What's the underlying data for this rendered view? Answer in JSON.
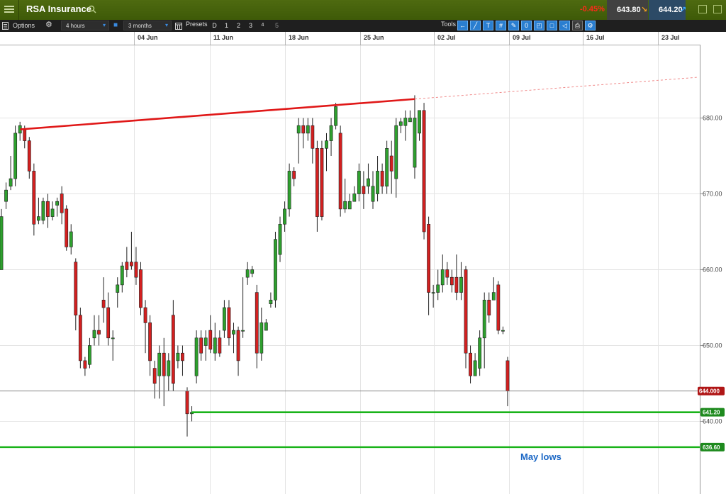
{
  "app": {
    "instrument": "RSA Insurance",
    "change": "-0.45%",
    "bid": "643.80",
    "ask": "644.20"
  },
  "toolbar": {
    "options_label": "Options",
    "interval": "4 hours",
    "range": "3 months",
    "presets_label": "Presets",
    "preset_items": [
      "D",
      "1",
      "2",
      "3",
      "4",
      "5"
    ],
    "tools_label": "Tools"
  },
  "colors": {
    "up": "#2ea02e",
    "down": "#d42020",
    "trendline": "#e01818",
    "support": "#19b319",
    "annotation": "#1b67c5"
  },
  "chart_data": {
    "type": "candlestick",
    "interval": "4 hours",
    "x_tick_labels": [
      "04 Jun",
      "11 Jun",
      "18 Jun",
      "25 Jun",
      "02 Jul",
      "09 Jul",
      "16 Jul",
      "23 Jul"
    ],
    "y_ticks": [
      640,
      650,
      660,
      670,
      680
    ],
    "ylim": [
      635,
      690
    ],
    "grid": true,
    "current_price": 644.0,
    "current_price_label": "644.000",
    "candles": [
      {
        "o": 660,
        "c": 667,
        "h": 668,
        "l": 660
      },
      {
        "o": 669,
        "c": 670.5,
        "h": 671.5,
        "l": 668
      },
      {
        "o": 671,
        "c": 672,
        "h": 675,
        "l": 670.5
      },
      {
        "o": 672,
        "c": 678,
        "h": 679,
        "l": 671
      },
      {
        "o": 678,
        "c": 679,
        "h": 679.5,
        "l": 677
      },
      {
        "o": 678.5,
        "c": 677,
        "h": 679,
        "l": 676
      },
      {
        "o": 677,
        "c": 673,
        "h": 677.5,
        "l": 672
      },
      {
        "o": 673,
        "c": 666,
        "h": 674,
        "l": 664.5
      },
      {
        "o": 666.5,
        "c": 667,
        "h": 669.5,
        "l": 666
      },
      {
        "o": 666.5,
        "c": 669,
        "h": 669.5,
        "l": 666
      },
      {
        "o": 669,
        "c": 667,
        "h": 670,
        "l": 665.5
      },
      {
        "o": 667,
        "c": 668,
        "h": 669,
        "l": 666.5
      },
      {
        "o": 668.5,
        "c": 669,
        "h": 669.5,
        "l": 667
      },
      {
        "o": 670,
        "c": 667.5,
        "h": 671,
        "l": 666
      },
      {
        "o": 668,
        "c": 663,
        "h": 668.5,
        "l": 662.5
      },
      {
        "o": 663,
        "c": 665,
        "h": 666,
        "l": 662
      },
      {
        "o": 661,
        "c": 654,
        "h": 661.5,
        "l": 652
      },
      {
        "o": 654,
        "c": 648,
        "h": 655,
        "l": 647
      },
      {
        "o": 648,
        "c": 647,
        "h": 648.5,
        "l": 646
      },
      {
        "o": 647.5,
        "c": 650,
        "h": 651,
        "l": 647
      },
      {
        "o": 651,
        "c": 652,
        "h": 654,
        "l": 650
      },
      {
        "o": 652,
        "c": 651.5,
        "h": 654,
        "l": 650
      },
      {
        "o": 656,
        "c": 655,
        "h": 659,
        "l": 653
      },
      {
        "o": 655,
        "c": 651,
        "h": 657,
        "l": 650
      },
      {
        "o": 651,
        "c": 651,
        "h": 652,
        "l": 648
      },
      {
        "o": 657,
        "c": 658,
        "h": 659,
        "l": 655
      },
      {
        "o": 658,
        "c": 660.5,
        "h": 661,
        "l": 657
      },
      {
        "o": 661,
        "c": 660,
        "h": 663,
        "l": 659
      },
      {
        "o": 661,
        "c": 660.5,
        "h": 665,
        "l": 660
      },
      {
        "o": 661,
        "c": 659,
        "h": 663,
        "l": 658
      },
      {
        "o": 660,
        "c": 655,
        "h": 661,
        "l": 654
      },
      {
        "o": 655,
        "c": 653,
        "h": 656,
        "l": 649
      },
      {
        "o": 653,
        "c": 648,
        "h": 654,
        "l": 646
      },
      {
        "o": 647,
        "c": 645,
        "h": 648,
        "l": 643
      },
      {
        "o": 646,
        "c": 649,
        "h": 650,
        "l": 643
      },
      {
        "o": 649,
        "c": 646,
        "h": 651,
        "l": 642
      },
      {
        "o": 646,
        "c": 648,
        "h": 649,
        "l": 644
      },
      {
        "o": 654,
        "c": 645,
        "h": 656,
        "l": 644
      },
      {
        "o": 648,
        "c": 649,
        "h": 650,
        "l": 647
      },
      {
        "o": 649,
        "c": 648,
        "h": 650,
        "l": 646
      },
      {
        "o": 644,
        "c": 641,
        "h": 644.5,
        "l": 638
      },
      {
        "o": 641,
        "c": 641.2,
        "h": 642,
        "l": 640
      },
      {
        "o": 646,
        "c": 651,
        "h": 652,
        "l": 645
      },
      {
        "o": 651,
        "c": 649,
        "h": 652,
        "l": 648
      },
      {
        "o": 650,
        "c": 651,
        "h": 652,
        "l": 648
      },
      {
        "o": 652,
        "c": 649.5,
        "h": 654,
        "l": 649
      },
      {
        "o": 649,
        "c": 651,
        "h": 653,
        "l": 648
      },
      {
        "o": 651,
        "c": 649,
        "h": 652,
        "l": 648.5
      },
      {
        "o": 652,
        "c": 655,
        "h": 656,
        "l": 651
      },
      {
        "o": 655,
        "c": 651,
        "h": 656,
        "l": 650
      },
      {
        "o": 651.5,
        "c": 652,
        "h": 653,
        "l": 649
      },
      {
        "o": 652,
        "c": 648,
        "h": 652.5,
        "l": 646
      },
      {
        "o": 652,
        "c": 652,
        "h": 659,
        "l": 651
      },
      {
        "o": 659,
        "c": 660,
        "h": 661,
        "l": 658
      },
      {
        "o": 659.5,
        "c": 660,
        "h": 660.5,
        "l": 659
      },
      {
        "o": 657,
        "c": 649,
        "h": 658,
        "l": 647
      },
      {
        "o": 649,
        "c": 653,
        "h": 655,
        "l": 648
      },
      {
        "o": 652,
        "c": 653,
        "h": 653.5,
        "l": 652
      },
      {
        "o": 655.5,
        "c": 656,
        "h": 657,
        "l": 655
      },
      {
        "o": 656,
        "c": 664,
        "h": 665,
        "l": 655
      },
      {
        "o": 662,
        "c": 666,
        "h": 667,
        "l": 661
      },
      {
        "o": 666,
        "c": 668,
        "h": 669,
        "l": 665
      },
      {
        "o": 668,
        "c": 673,
        "h": 674,
        "l": 667
      },
      {
        "o": 673,
        "c": 672,
        "h": 673.5,
        "l": 671
      },
      {
        "o": 678,
        "c": 679,
        "h": 680,
        "l": 674
      },
      {
        "o": 679,
        "c": 678,
        "h": 680,
        "l": 676
      },
      {
        "o": 678,
        "c": 679,
        "h": 680,
        "l": 677
      },
      {
        "o": 679,
        "c": 676,
        "h": 680,
        "l": 674
      },
      {
        "o": 676,
        "c": 667,
        "h": 677,
        "l": 665
      },
      {
        "o": 676,
        "c": 667,
        "h": 677,
        "l": 666.5
      },
      {
        "o": 676,
        "c": 677,
        "h": 678,
        "l": 673
      },
      {
        "o": 677,
        "c": 679,
        "h": 680,
        "l": 675
      },
      {
        "o": 679,
        "c": 681.5,
        "h": 682,
        "l": 678.5
      },
      {
        "o": 678,
        "c": 668,
        "h": 679,
        "l": 667
      },
      {
        "o": 668,
        "c": 669,
        "h": 672,
        "l": 667.5
      },
      {
        "o": 668,
        "c": 669,
        "h": 670,
        "l": 668
      },
      {
        "o": 669,
        "c": 670,
        "h": 671,
        "l": 669
      },
      {
        "o": 670,
        "c": 673,
        "h": 674,
        "l": 669
      },
      {
        "o": 671,
        "c": 670,
        "h": 673,
        "l": 668
      },
      {
        "o": 671,
        "c": 672,
        "h": 674,
        "l": 670
      },
      {
        "o": 669,
        "c": 671,
        "h": 673,
        "l": 668
      },
      {
        "o": 670,
        "c": 673,
        "h": 675,
        "l": 669
      },
      {
        "o": 673,
        "c": 671,
        "h": 674,
        "l": 670
      },
      {
        "o": 671,
        "c": 676,
        "h": 677,
        "l": 670
      },
      {
        "o": 675,
        "c": 673,
        "h": 677,
        "l": 670
      },
      {
        "o": 672,
        "c": 679,
        "h": 680,
        "l": 669.5
      },
      {
        "o": 679,
        "c": 679.5,
        "h": 680,
        "l": 678
      },
      {
        "o": 679,
        "c": 680,
        "h": 681,
        "l": 677
      },
      {
        "o": 679.5,
        "c": 680,
        "h": 681,
        "l": 679.5
      },
      {
        "o": 673.5,
        "c": 680,
        "h": 683,
        "l": 672
      },
      {
        "o": 678,
        "c": 681,
        "h": 681,
        "l": 677
      },
      {
        "o": 681,
        "c": 665,
        "h": 682,
        "l": 664
      },
      {
        "o": 666,
        "c": 657,
        "h": 667,
        "l": 654
      },
      {
        "o": 657,
        "c": 657,
        "h": 658,
        "l": 655
      },
      {
        "o": 657,
        "c": 658,
        "h": 660,
        "l": 656
      },
      {
        "o": 658,
        "c": 660,
        "h": 662,
        "l": 657
      },
      {
        "o": 660,
        "c": 659,
        "h": 661,
        "l": 658
      },
      {
        "o": 659,
        "c": 658,
        "h": 660,
        "l": 657
      },
      {
        "o": 659,
        "c": 657,
        "h": 662,
        "l": 656
      },
      {
        "o": 657,
        "c": 659,
        "h": 661,
        "l": 656
      },
      {
        "o": 660,
        "c": 649,
        "h": 660.5,
        "l": 647
      },
      {
        "o": 649,
        "c": 646,
        "h": 650,
        "l": 645
      },
      {
        "o": 646,
        "c": 648,
        "h": 649,
        "l": 646
      },
      {
        "o": 647,
        "c": 651,
        "h": 652,
        "l": 646
      },
      {
        "o": 651,
        "c": 656,
        "h": 657,
        "l": 647
      },
      {
        "o": 656,
        "c": 654,
        "h": 657,
        "l": 653
      },
      {
        "o": 656,
        "c": 657,
        "h": 659,
        "l": 656
      },
      {
        "o": 658,
        "c": 652,
        "h": 658.5,
        "l": 651.5
      },
      {
        "o": 652,
        "c": 652,
        "h": 652.5,
        "l": 651.5
      },
      {
        "o": 648,
        "c": 644,
        "h": 648.5,
        "l": 642
      }
    ],
    "annotations": {
      "trendline": {
        "from": {
          "price": 678.5
        },
        "to": {
          "price": 682.5
        }
      },
      "support_levels": [
        {
          "price": 641.2,
          "label": "641.20"
        },
        {
          "price": 636.6,
          "label": "636.60"
        }
      ],
      "note": "May lows"
    }
  }
}
